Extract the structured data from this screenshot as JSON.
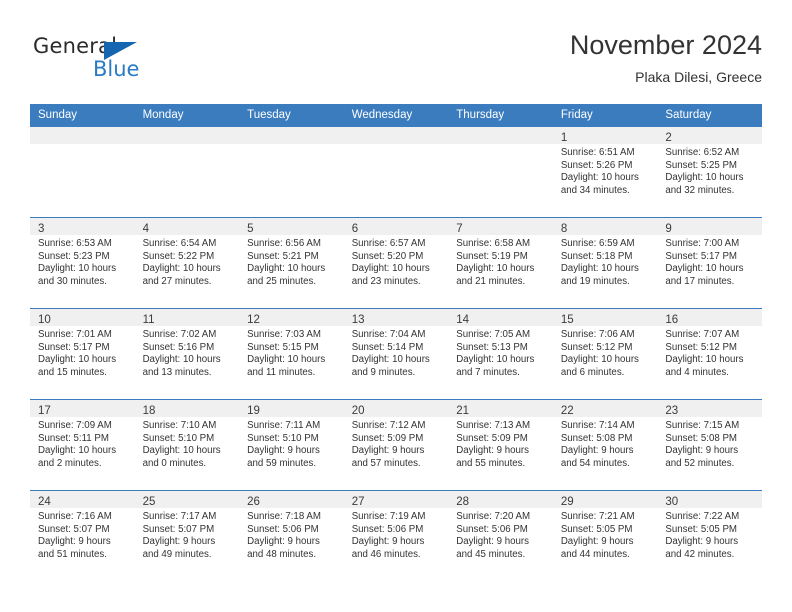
{
  "brand": {
    "name_top": "General",
    "name_bottom": "Blue",
    "accent_color": "#2a7ac4",
    "triangle_color": "#1565b0"
  },
  "header": {
    "month_title": "November 2024",
    "location": "Plaka Dilesi, Greece",
    "header_bg_color": "#3a7cbe"
  },
  "calendar": {
    "weekday_headers": [
      "Sunday",
      "Monday",
      "Tuesday",
      "Wednesday",
      "Thursday",
      "Friday",
      "Saturday"
    ],
    "weeks": [
      [
        {
          "day": "",
          "sunrise": "",
          "sunset": "",
          "daylight": "",
          "empty": true
        },
        {
          "day": "",
          "sunrise": "",
          "sunset": "",
          "daylight": "",
          "empty": true
        },
        {
          "day": "",
          "sunrise": "",
          "sunset": "",
          "daylight": "",
          "empty": true
        },
        {
          "day": "",
          "sunrise": "",
          "sunset": "",
          "daylight": "",
          "empty": true
        },
        {
          "day": "",
          "sunrise": "",
          "sunset": "",
          "daylight": "",
          "empty": true
        },
        {
          "day": "1",
          "sunrise": "Sunrise: 6:51 AM",
          "sunset": "Sunset: 5:26 PM",
          "daylight": "Daylight: 10 hours and 34 minutes.",
          "empty": false
        },
        {
          "day": "2",
          "sunrise": "Sunrise: 6:52 AM",
          "sunset": "Sunset: 5:25 PM",
          "daylight": "Daylight: 10 hours and 32 minutes.",
          "empty": false
        }
      ],
      [
        {
          "day": "3",
          "sunrise": "Sunrise: 6:53 AM",
          "sunset": "Sunset: 5:23 PM",
          "daylight": "Daylight: 10 hours and 30 minutes.",
          "empty": false
        },
        {
          "day": "4",
          "sunrise": "Sunrise: 6:54 AM",
          "sunset": "Sunset: 5:22 PM",
          "daylight": "Daylight: 10 hours and 27 minutes.",
          "empty": false
        },
        {
          "day": "5",
          "sunrise": "Sunrise: 6:56 AM",
          "sunset": "Sunset: 5:21 PM",
          "daylight": "Daylight: 10 hours and 25 minutes.",
          "empty": false
        },
        {
          "day": "6",
          "sunrise": "Sunrise: 6:57 AM",
          "sunset": "Sunset: 5:20 PM",
          "daylight": "Daylight: 10 hours and 23 minutes.",
          "empty": false
        },
        {
          "day": "7",
          "sunrise": "Sunrise: 6:58 AM",
          "sunset": "Sunset: 5:19 PM",
          "daylight": "Daylight: 10 hours and 21 minutes.",
          "empty": false
        },
        {
          "day": "8",
          "sunrise": "Sunrise: 6:59 AM",
          "sunset": "Sunset: 5:18 PM",
          "daylight": "Daylight: 10 hours and 19 minutes.",
          "empty": false
        },
        {
          "day": "9",
          "sunrise": "Sunrise: 7:00 AM",
          "sunset": "Sunset: 5:17 PM",
          "daylight": "Daylight: 10 hours and 17 minutes.",
          "empty": false
        }
      ],
      [
        {
          "day": "10",
          "sunrise": "Sunrise: 7:01 AM",
          "sunset": "Sunset: 5:17 PM",
          "daylight": "Daylight: 10 hours and 15 minutes.",
          "empty": false
        },
        {
          "day": "11",
          "sunrise": "Sunrise: 7:02 AM",
          "sunset": "Sunset: 5:16 PM",
          "daylight": "Daylight: 10 hours and 13 minutes.",
          "empty": false
        },
        {
          "day": "12",
          "sunrise": "Sunrise: 7:03 AM",
          "sunset": "Sunset: 5:15 PM",
          "daylight": "Daylight: 10 hours and 11 minutes.",
          "empty": false
        },
        {
          "day": "13",
          "sunrise": "Sunrise: 7:04 AM",
          "sunset": "Sunset: 5:14 PM",
          "daylight": "Daylight: 10 hours and 9 minutes.",
          "empty": false
        },
        {
          "day": "14",
          "sunrise": "Sunrise: 7:05 AM",
          "sunset": "Sunset: 5:13 PM",
          "daylight": "Daylight: 10 hours and 7 minutes.",
          "empty": false
        },
        {
          "day": "15",
          "sunrise": "Sunrise: 7:06 AM",
          "sunset": "Sunset: 5:12 PM",
          "daylight": "Daylight: 10 hours and 6 minutes.",
          "empty": false
        },
        {
          "day": "16",
          "sunrise": "Sunrise: 7:07 AM",
          "sunset": "Sunset: 5:12 PM",
          "daylight": "Daylight: 10 hours and 4 minutes.",
          "empty": false
        }
      ],
      [
        {
          "day": "17",
          "sunrise": "Sunrise: 7:09 AM",
          "sunset": "Sunset: 5:11 PM",
          "daylight": "Daylight: 10 hours and 2 minutes.",
          "empty": false
        },
        {
          "day": "18",
          "sunrise": "Sunrise: 7:10 AM",
          "sunset": "Sunset: 5:10 PM",
          "daylight": "Daylight: 10 hours and 0 minutes.",
          "empty": false
        },
        {
          "day": "19",
          "sunrise": "Sunrise: 7:11 AM",
          "sunset": "Sunset: 5:10 PM",
          "daylight": "Daylight: 9 hours and 59 minutes.",
          "empty": false
        },
        {
          "day": "20",
          "sunrise": "Sunrise: 7:12 AM",
          "sunset": "Sunset: 5:09 PM",
          "daylight": "Daylight: 9 hours and 57 minutes.",
          "empty": false
        },
        {
          "day": "21",
          "sunrise": "Sunrise: 7:13 AM",
          "sunset": "Sunset: 5:09 PM",
          "daylight": "Daylight: 9 hours and 55 minutes.",
          "empty": false
        },
        {
          "day": "22",
          "sunrise": "Sunrise: 7:14 AM",
          "sunset": "Sunset: 5:08 PM",
          "daylight": "Daylight: 9 hours and 54 minutes.",
          "empty": false
        },
        {
          "day": "23",
          "sunrise": "Sunrise: 7:15 AM",
          "sunset": "Sunset: 5:08 PM",
          "daylight": "Daylight: 9 hours and 52 minutes.",
          "empty": false
        }
      ],
      [
        {
          "day": "24",
          "sunrise": "Sunrise: 7:16 AM",
          "sunset": "Sunset: 5:07 PM",
          "daylight": "Daylight: 9 hours and 51 minutes.",
          "empty": false
        },
        {
          "day": "25",
          "sunrise": "Sunrise: 7:17 AM",
          "sunset": "Sunset: 5:07 PM",
          "daylight": "Daylight: 9 hours and 49 minutes.",
          "empty": false
        },
        {
          "day": "26",
          "sunrise": "Sunrise: 7:18 AM",
          "sunset": "Sunset: 5:06 PM",
          "daylight": "Daylight: 9 hours and 48 minutes.",
          "empty": false
        },
        {
          "day": "27",
          "sunrise": "Sunrise: 7:19 AM",
          "sunset": "Sunset: 5:06 PM",
          "daylight": "Daylight: 9 hours and 46 minutes.",
          "empty": false
        },
        {
          "day": "28",
          "sunrise": "Sunrise: 7:20 AM",
          "sunset": "Sunset: 5:06 PM",
          "daylight": "Daylight: 9 hours and 45 minutes.",
          "empty": false
        },
        {
          "day": "29",
          "sunrise": "Sunrise: 7:21 AM",
          "sunset": "Sunset: 5:05 PM",
          "daylight": "Daylight: 9 hours and 44 minutes.",
          "empty": false
        },
        {
          "day": "30",
          "sunrise": "Sunrise: 7:22 AM",
          "sunset": "Sunset: 5:05 PM",
          "daylight": "Daylight: 9 hours and 42 minutes.",
          "empty": false
        }
      ]
    ]
  }
}
